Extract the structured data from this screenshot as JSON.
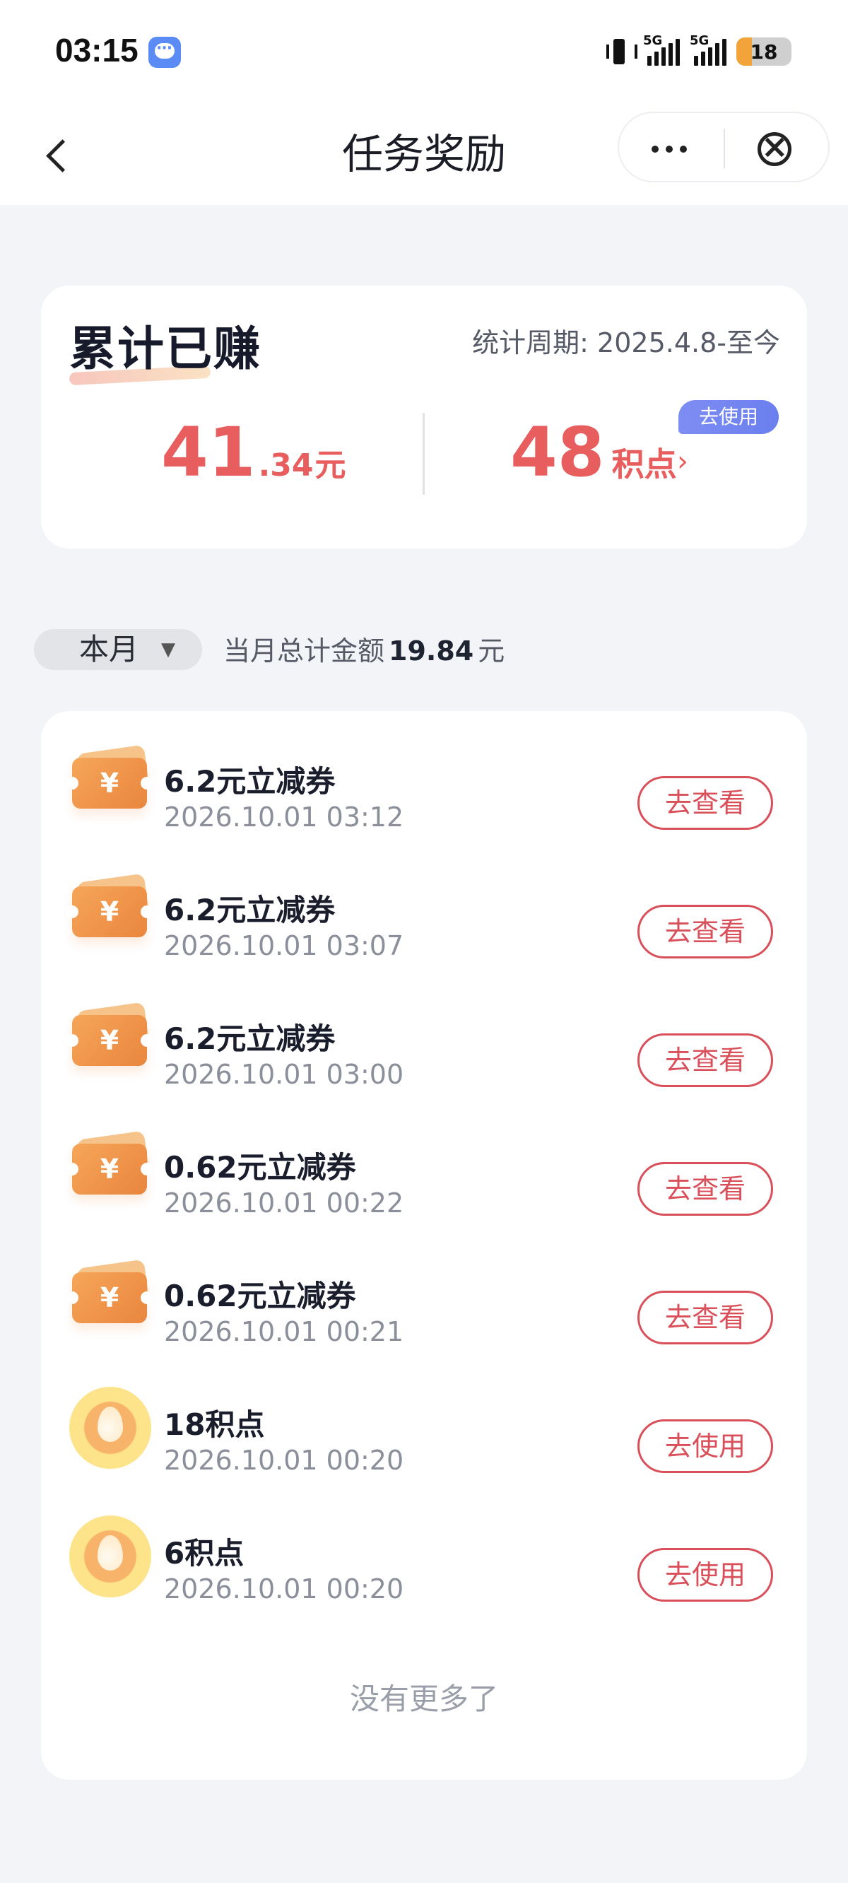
{
  "status_bar": {
    "time": "03:15",
    "network_1": "5G",
    "network_2": "5G",
    "battery": "18"
  },
  "nav": {
    "title": "任务奖励"
  },
  "summary": {
    "title": "累计已赚",
    "period": "统计周期: 2025.4.8-至今",
    "money_integer": "41",
    "money_decimal": ".34",
    "money_unit": "元",
    "points_value": "48",
    "points_unit": "积点",
    "points_arrow": "›",
    "use_badge": "去使用"
  },
  "filter": {
    "month_label": "本月",
    "month_caret": "▼",
    "total_prefix": "当月总计金额",
    "total_amount": "19.84",
    "total_unit": "元"
  },
  "items": [
    {
      "type": "coupon",
      "title": "6.2元立减券",
      "time": "2026.10.01 03:12",
      "action": "去查看"
    },
    {
      "type": "coupon",
      "title": "6.2元立减券",
      "time": "2026.10.01 03:07",
      "action": "去查看"
    },
    {
      "type": "coupon",
      "title": "6.2元立减券",
      "time": "2026.10.01 03:00",
      "action": "去查看"
    },
    {
      "type": "coupon",
      "title": "0.62元立减券",
      "time": "2026.10.01 00:22",
      "action": "去查看"
    },
    {
      "type": "coupon",
      "title": "0.62元立减券",
      "time": "2026.10.01 00:21",
      "action": "去查看"
    },
    {
      "type": "points",
      "title": "18积点",
      "time": "2026.10.01 00:20",
      "action": "去使用"
    },
    {
      "type": "points",
      "title": "6积点",
      "time": "2026.10.01 00:20",
      "action": "去使用"
    }
  ],
  "list_footer": "没有更多了",
  "icons": {
    "coupon": "yen-coupon-icon",
    "coupon_glyph": "¥",
    "points": "points-drop-icon"
  },
  "colors": {
    "accent_red": "#e85d5d",
    "button_red": "#d9505a",
    "badge_blue": "#6a7fee",
    "page_bg": "#f3f4f7"
  }
}
